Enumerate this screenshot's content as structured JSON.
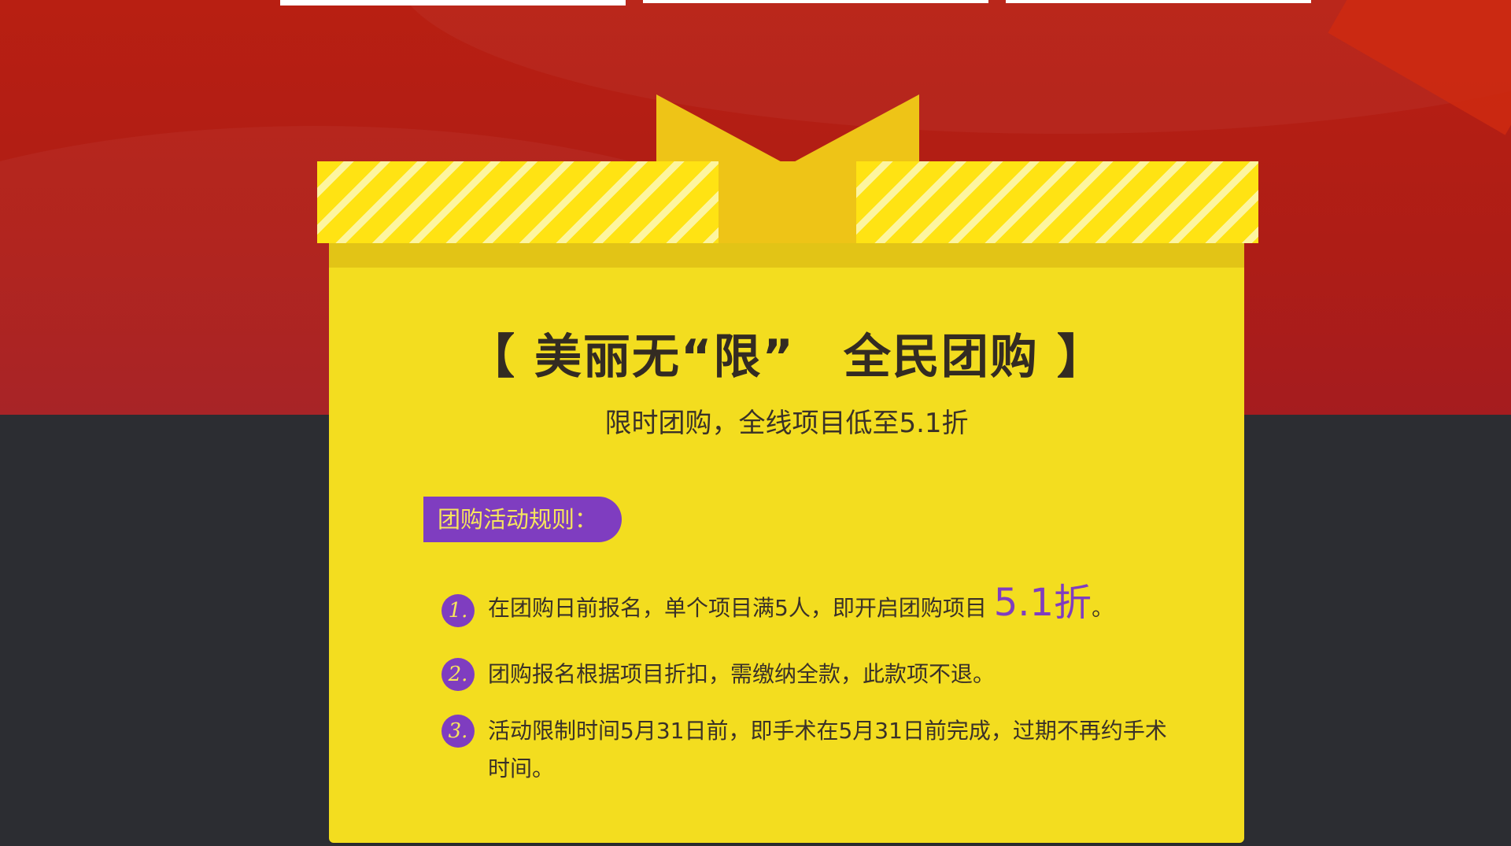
{
  "header_tabs": [
    "",
    "",
    ""
  ],
  "colors": {
    "red_background": "#b51e14",
    "dark_background": "#2c2d32",
    "box_yellow": "#f3dd1f",
    "ribbon_yellow": "#eec417",
    "accent_purple": "#7f3dc0",
    "badge_text": "#f6e55d"
  },
  "promo": {
    "title": "【 美丽无“限”　全民团购 】",
    "subtitle": "限时团购，全线项目低至5.1折",
    "rules_label": "团购活动规则：",
    "rules": [
      {
        "number": "1.",
        "text": "在团购日前报名，单个项目满5人，即开启团购项目 ",
        "highlight": "5.1折",
        "suffix": "。"
      },
      {
        "number": "2.",
        "text": "团购报名根据项目折扣，需缴纳全款，此款项不退。"
      },
      {
        "number": "3.",
        "text": "活动限制时间5月31日前，即手术在5月31日前完成，过期不再约手术时间。"
      }
    ]
  }
}
